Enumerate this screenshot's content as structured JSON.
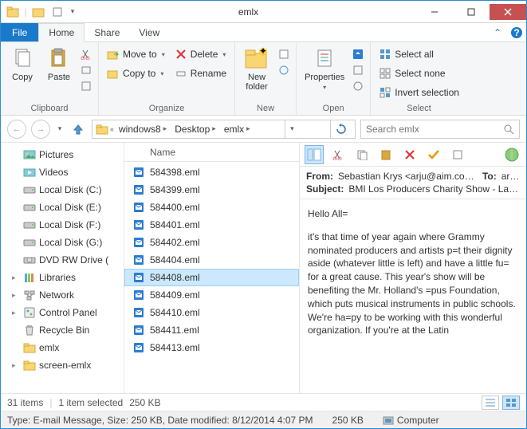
{
  "window": {
    "title": "emlx"
  },
  "qat": {
    "dropdown": "▾"
  },
  "tabs": {
    "file": "File",
    "home": "Home",
    "share": "Share",
    "view": "View"
  },
  "ribbon": {
    "clipboard": {
      "label": "Clipboard",
      "copy": "Copy",
      "paste": "Paste"
    },
    "organize": {
      "label": "Organize",
      "moveto": "Move to",
      "copyto": "Copy to",
      "delete": "Delete",
      "rename": "Rename"
    },
    "new": {
      "label": "New",
      "newfolder": "New\nfolder"
    },
    "open": {
      "label": "Open",
      "properties": "Properties"
    },
    "select": {
      "label": "Select",
      "all": "Select all",
      "none": "Select none",
      "invert": "Invert selection"
    }
  },
  "breadcrumb": {
    "items": [
      "windows8",
      "Desktop",
      "emlx"
    ],
    "chev": "«"
  },
  "search": {
    "placeholder": "Search emlx"
  },
  "nav": {
    "items": [
      {
        "label": "Pictures",
        "icon": "pictures"
      },
      {
        "label": "Videos",
        "icon": "videos"
      },
      {
        "label": "Local Disk (C:)",
        "icon": "disk"
      },
      {
        "label": "Local Disk (E:)",
        "icon": "disk"
      },
      {
        "label": "Local Disk (F:)",
        "icon": "disk"
      },
      {
        "label": "Local Disk (G:)",
        "icon": "disk"
      },
      {
        "label": "DVD RW Drive (",
        "icon": "dvd"
      },
      {
        "label": "Libraries",
        "icon": "libraries",
        "tw": "▸"
      },
      {
        "label": "Network",
        "icon": "network",
        "tw": "▸"
      },
      {
        "label": "Control Panel",
        "icon": "control",
        "tw": "▸"
      },
      {
        "label": "Recycle Bin",
        "icon": "recycle",
        "tw": ""
      },
      {
        "label": "emlx",
        "icon": "folder",
        "tw": ""
      },
      {
        "label": "screen-emlx",
        "icon": "folder",
        "tw": "▸"
      }
    ]
  },
  "filelist": {
    "header": "Name",
    "items": [
      "584398.eml",
      "584399.eml",
      "584400.eml",
      "584401.eml",
      "584402.eml",
      "584404.eml",
      "584408.eml",
      "584409.eml",
      "584410.eml",
      "584411.eml",
      "584413.eml"
    ],
    "selectedIndex": 6
  },
  "preview": {
    "from_label": "From:",
    "from_value": "Sebastian Krys <arju@aim.com>",
    "to_label": "To:",
    "to_value": "arj...",
    "subject_label": "Subject:",
    "subject_value": "BMI Los Producers Charity Show - Las ...",
    "body_greeting": "Hello All=",
    "body_text": "it's that time of year again where Grammy nominated producers and artists p=t their dignity aside (whatever little is left)  and have a little fu= for a great cause. This year's show will be benefiting the Mr. Holland's =pus Foundation, which puts musical instruments in public schools. We're ha=py to be working with this wonderful organization. If you're at the Latin"
  },
  "status1": {
    "count": "31 items",
    "selected": "1 item selected",
    "size": "250 KB"
  },
  "status2": {
    "type": "Type: E-mail Message, Size: 250 KB, Date modified: 8/12/2014 4:07 PM",
    "size": "250 KB",
    "location": "Computer"
  }
}
